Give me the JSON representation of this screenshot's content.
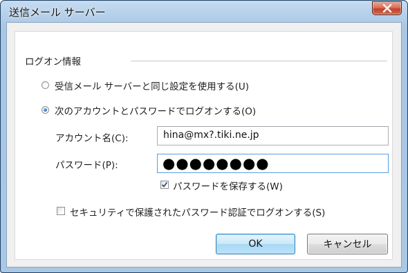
{
  "window": {
    "title": "送信メール サーバー"
  },
  "group": {
    "label": "ログオン情報"
  },
  "options": {
    "same_as_incoming": {
      "label": "受信メール サーバーと同じ設定を使用する(U)",
      "checked": false
    },
    "logon_with_account": {
      "label": "次のアカウントとパスワードでログオンする(O)",
      "checked": true
    }
  },
  "fields": {
    "account": {
      "label": "アカウント名(C):",
      "value": "hina@mx?.tiki.ne.jp"
    },
    "password": {
      "label": "パスワード(P):",
      "masked_value": "●●●●●●●●"
    }
  },
  "remember_password": {
    "label": "パスワードを保存する(W)",
    "checked": true
  },
  "secure_password_auth": {
    "label": "セキュリティで保護されたパスワード認証でログオンする(S)",
    "checked": false
  },
  "buttons": {
    "ok": "OK",
    "cancel": "キャンセル",
    "close_symbol": "X"
  },
  "icons": {
    "close": "close-icon",
    "checkmark": "checkmark-icon"
  },
  "colors": {
    "title_bar": "#b5d0ea",
    "close_button": "#c1412a",
    "focus_border": "#569de5",
    "radio_dot": "#1b5fa8"
  }
}
